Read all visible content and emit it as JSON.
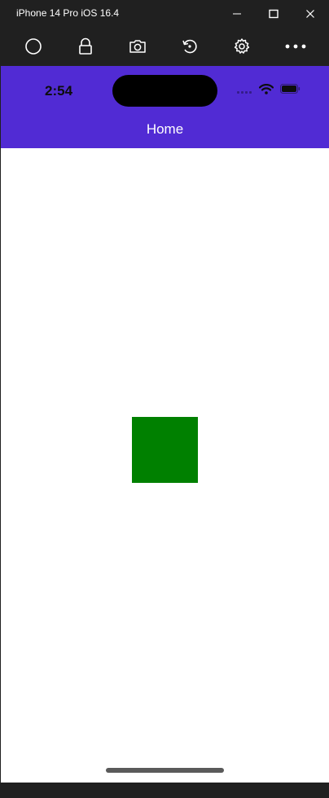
{
  "window": {
    "title": "iPhone 14 Pro iOS 16.4",
    "controls": {
      "minimize": "minimize-icon",
      "maximize": "maximize-icon",
      "close": "close-icon"
    }
  },
  "toolbar": {
    "items": [
      {
        "icon": "home-circle-icon"
      },
      {
        "icon": "lock-icon"
      },
      {
        "icon": "camera-icon"
      },
      {
        "icon": "rotate-icon"
      },
      {
        "icon": "gear-icon"
      },
      {
        "icon": "more-icon"
      }
    ]
  },
  "device": {
    "status_bar": {
      "time": "2:54"
    },
    "nav_bar": {
      "title": "Home"
    }
  },
  "colors": {
    "accent": "#512BD4",
    "box": "#008000",
    "chrome": "#202020"
  }
}
